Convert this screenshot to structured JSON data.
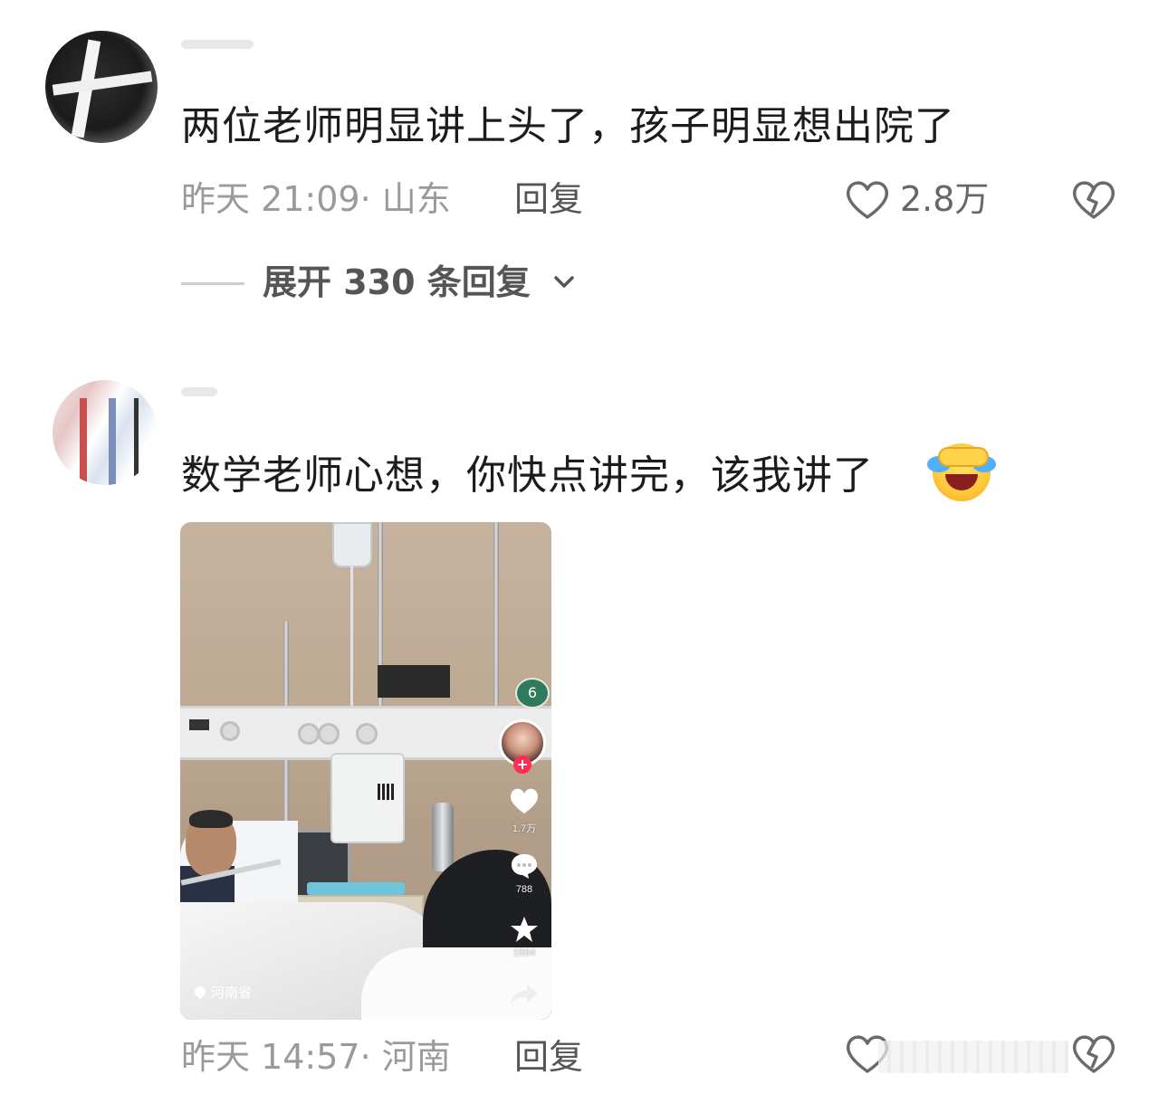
{
  "comments": [
    {
      "text": "两位老师明显讲上头了，孩子明显想出院了",
      "meta": "昨天 21:09· 山东",
      "reply_label": "回复",
      "likes": "2.8万",
      "expand_label": "展开 330 条回复"
    },
    {
      "text": "数学老师心想，你快点讲完，该我讲了",
      "meta": "昨天 14:57· 河南",
      "reply_label": "回复",
      "video": {
        "location": "河南省",
        "room_number": "6",
        "likes": "1.7万",
        "comments": "788",
        "favorites": "1564"
      }
    }
  ],
  "icons": {
    "like": "heart-outline-icon",
    "dislike": "broken-heart-icon",
    "expand": "chevron-down-icon",
    "emoji": "rolling-laughing-emoji"
  },
  "colors": {
    "text": "#1c1c1c",
    "meta": "#9a9a9a",
    "accent": "#ff2c55"
  }
}
